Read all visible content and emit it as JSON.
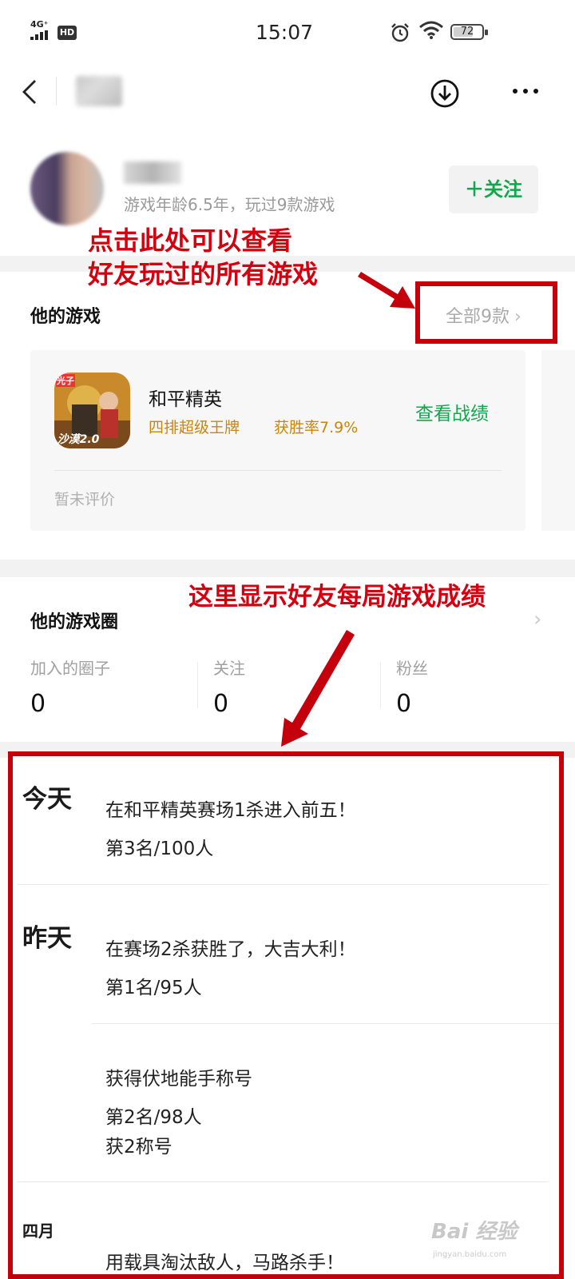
{
  "status_bar": {
    "network": "4G⁺",
    "hd": "HD",
    "time": "15:07",
    "battery": "72",
    "battery_level": 0.72
  },
  "nav": {
    "back_icon": "chevron-left-icon",
    "download_icon": "download-circle-icon",
    "more_icon": "more-horizontal-icon"
  },
  "profile": {
    "subtitle": "游戏年龄6.5年，玩过9款游戏",
    "follow_label": "＋关注",
    "accent_color": "#10a84c"
  },
  "games": {
    "title": "他的游戏",
    "see_all": "全部9款",
    "card": {
      "name": "和平精英",
      "tag": "四排超级王牌",
      "win_rate": "获胜率7.9%",
      "action": "查看战绩",
      "review": "暂未评价",
      "icon_badge": "光子",
      "icon_caption": "沙漠2.0"
    }
  },
  "circle": {
    "title": "他的游戏圈",
    "stats": [
      {
        "label": "加入的圈子",
        "value": "0"
      },
      {
        "label": "关注",
        "value": "0"
      },
      {
        "label": "粉丝",
        "value": "0"
      }
    ]
  },
  "feed": {
    "days": [
      "今天",
      "昨天",
      "四月"
    ],
    "items": [
      {
        "title": "在和平精英赛场1杀进入前五！",
        "detail": "第3名/100人"
      },
      {
        "title": "在赛场2杀获胜了，大吉大利！",
        "detail": "第1名/95人"
      },
      {
        "title": "获得伏地能手称号",
        "detail": "第2名/98人",
        "detail2": "获2称号"
      },
      {
        "title": "用载具淘汰敌人，马路杀手！"
      }
    ]
  },
  "annotations": {
    "games_hint_line1": "点击此处可以查看",
    "games_hint_line2": "好友玩过的所有游戏",
    "feed_hint": "这里显示好友每局游戏成绩",
    "color": "#d4000f"
  },
  "watermark": {
    "text": "Bai 经验",
    "sub": "jingyan.baidu.com"
  }
}
